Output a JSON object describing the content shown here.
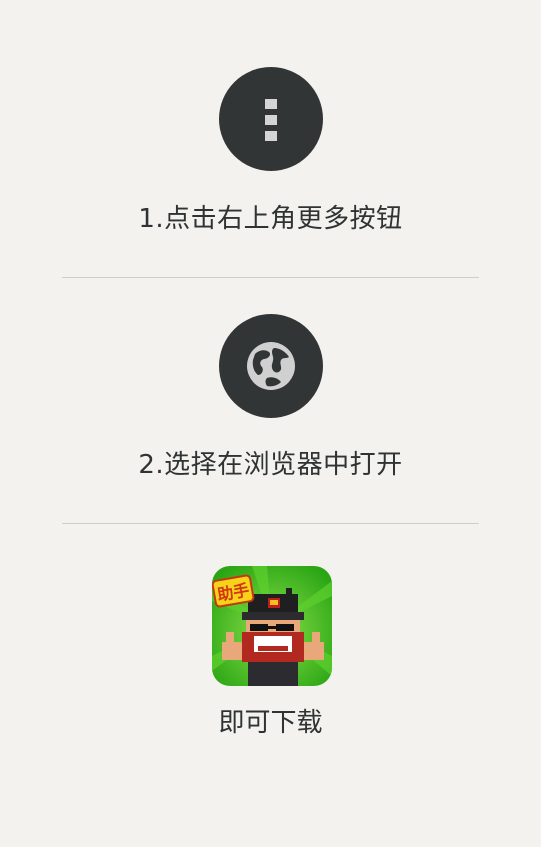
{
  "steps": [
    {
      "icon": "more-vertical-icon",
      "label": "1.点击右上角更多按钮"
    },
    {
      "icon": "globe-icon",
      "label": "2.选择在浏览器中打开"
    }
  ],
  "app": {
    "icon_badge": "助手",
    "download_label": "即可下载"
  },
  "colors": {
    "background": "#f3f2ee",
    "circle": "#323535",
    "text": "#2f3333",
    "divider": "#cfcdc9",
    "icon_green": "#3fbe1a",
    "badge_yellow": "#f6d21a"
  }
}
